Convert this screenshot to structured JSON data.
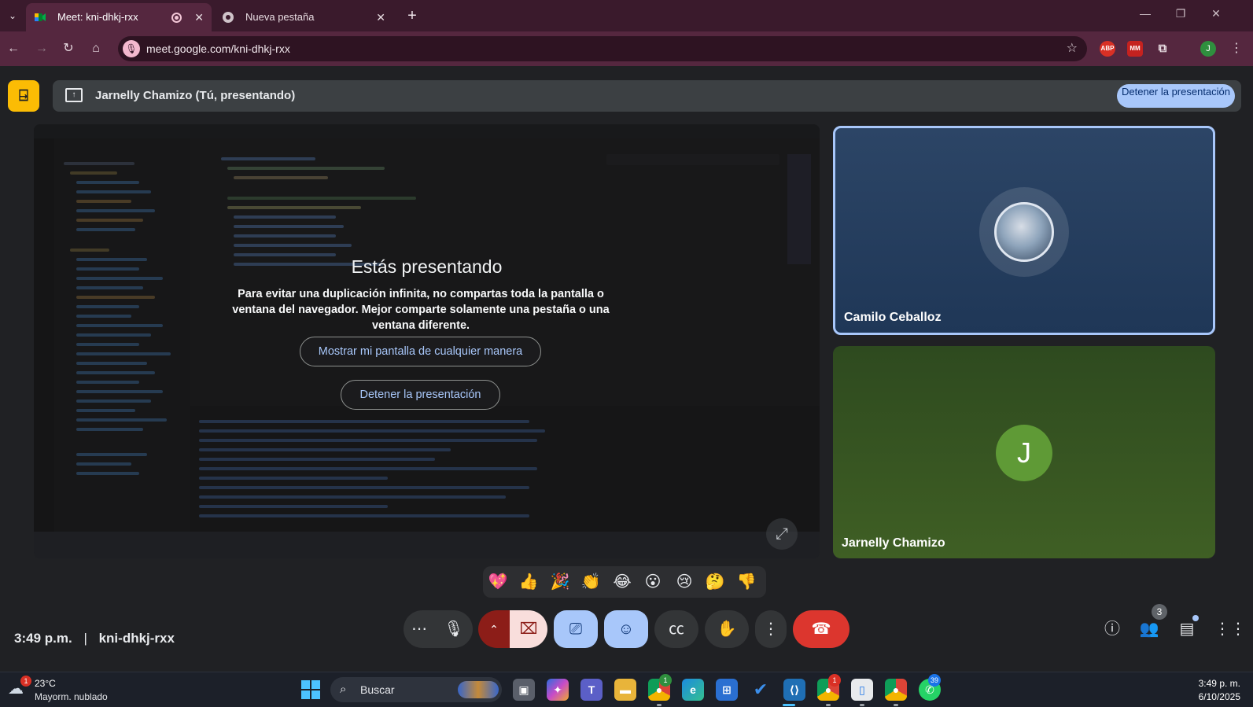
{
  "browser": {
    "tabs": [
      {
        "title": "Meet: kni-dhkj-rxx",
        "active": true,
        "recording": true
      },
      {
        "title": "Nueva pestaña",
        "active": false
      }
    ],
    "url": "meet.google.com/kni-dhkj-rxx",
    "extensions": [
      "ABP",
      "MM",
      "extensions-icon"
    ],
    "profile_initial": "J",
    "colors": {
      "tabbar": "#3a1a2c",
      "toolbar": "#55273f"
    }
  },
  "meet": {
    "presenting_banner": "Jarnelly Chamizo (Tú, presentando)",
    "stop_presenting_top": "Detener la presentación",
    "warning": {
      "title": "Estás presentando",
      "body": "Para evitar una duplicación infinita, no compartas toda la pantalla o ventana del navegador. Mejor comparte solamente una pestaña o una ventana diferente.",
      "show_anyway": "Mostrar mi pantalla de cualquier manera",
      "stop": "Detener la presentación"
    },
    "participants": [
      {
        "name": "Camilo Ceballoz",
        "avatar": "photo",
        "speaking_highlight": true
      },
      {
        "name": "Jarnelly Chamizo",
        "avatar": "J"
      }
    ],
    "reactions": [
      "💖",
      "👍",
      "🎉",
      "👏",
      "😂",
      "😮",
      "😢",
      "🤔",
      "👎"
    ],
    "time": "3:49 p.m.",
    "separator": "|",
    "meeting_code": "kni-dhkj-rxx",
    "people_count": "3",
    "controls": [
      "more-options",
      "microphone",
      "camera-toggle-menu",
      "camera-off",
      "present-screen",
      "reactions",
      "captions",
      "raise-hand",
      "more-vert",
      "end-call"
    ],
    "colors": {
      "accent": "#a8c7fa",
      "hangup": "#dc362e",
      "camera_off_bg": "#f9dedc"
    }
  },
  "taskbar": {
    "weather_temp": "23°C",
    "weather_desc": "Mayorm. nublado",
    "weather_badge": "1",
    "search_placeholder": "Buscar",
    "chrome_badge_1": "1",
    "chrome_badge_2": "1",
    "whatsapp_badge": "39",
    "time": "3:49 p. m.",
    "date": "6/10/2025"
  }
}
